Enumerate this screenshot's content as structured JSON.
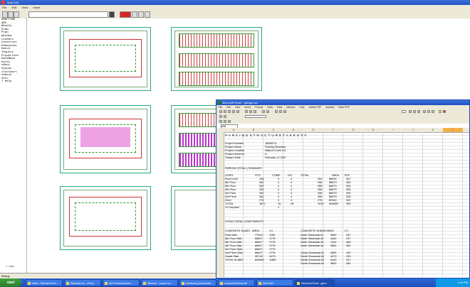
{
  "autocad": {
    "title": "AutoCAD",
    "menu": [
      "File",
      "Edit",
      "View",
      "Insert"
    ],
    "side_commands": [
      "DRAFTING",
      "ARX",
      "Modify",
      "Draw",
      "Plan",
      "Window",
      "Linears",
      "Construct",
      "Dimension",
      "Hatch",
      "Inquire",
      "Properties",
      "DataBase",
      "Units",
      "xBest",
      "Output",
      "xToolbars",
      "xHatch",
      "xEtc",
      "? Help"
    ],
    "status": "Ready",
    "layout_label": "< > A L"
  },
  "excel": {
    "title": "Microsoft Excel - garage.csv",
    "menu": [
      "File",
      "Edit",
      "View",
      "Insert",
      "Format",
      "Tools",
      "Data",
      "Window",
      "Help",
      "Adobe PDF",
      "Acrobat",
      "Inline PDF"
    ],
    "name_box": "A38",
    "columns": [
      "A",
      "B",
      "C",
      "D",
      "E",
      "F",
      "G",
      "H",
      "I",
      "J",
      "K",
      "L",
      "M"
    ],
    "sheet_title": "P A R K I N G   S T R U C T U R E   T A K E O F F",
    "project": [
      [
        "Project Number",
        "JAMEP-A"
      ],
      [
        "Project Name",
        "Parking Structure"
      ],
      [
        "Project Location",
        "Walnut Creek CA"
      ],
      [
        "Project Scheme",
        "A"
      ],
      [
        "Today's Date",
        "February 12 2007"
      ]
    ],
    "stall_summary_title": "PARKING (STALL) SUMMARY",
    "stall_headers": [
      "LEVEL",
      "STD",
      "COMP",
      "H/C",
      "TOTAL",
      "AREA",
      "EFF"
    ],
    "stall_rows": [
      [
        "Roof Level",
        "246",
        "4",
        "4",
        "254",
        "88046",
        "347"
      ],
      [
        "6th Floor",
        "262",
        "4",
        "4",
        "266",
        "86879",
        "326"
      ],
      [
        "5th Floor",
        "262",
        "4",
        "4",
        "266",
        "86879",
        "326"
      ],
      [
        "4th Floor",
        "262",
        "4",
        "4",
        "266",
        "86879",
        "326"
      ],
      [
        "3rd Floor",
        "262",
        "4",
        "4",
        "266",
        "86879",
        "326"
      ],
      [
        "2nd Floor",
        "262",
        "4",
        "4",
        "266",
        "86879",
        "326"
      ],
      [
        "Grnd",
        "270",
        "4",
        "4",
        "278",
        "89160",
        "320"
      ],
      [
        "TOTAL",
        "1871",
        "16",
        "28",
        "1915",
        "604869",
        "326"
      ],
      [
        "% Compact",
        "",
        "1",
        "",
        "",
        "",
        ""
      ]
    ],
    "structural_title": "STRUCTURAL COMPONENTS",
    "struct_headers": [
      "CONCRETE SLABS",
      "AREA",
      "CY",
      "CONCRETE SHEAR AREA",
      "CY"
    ],
    "struct_rows": [
      [
        "Roof Slab",
        "77410",
        "1152",
        "North Shearwall #1",
        "3892",
        "187"
      ],
      [
        "6th Floor Slab",
        "86627",
        "1775",
        "North Shearwall #2",
        "4442",
        "247"
      ],
      [
        "5th Floor Slab",
        "86627",
        "1775",
        "North Shearwall #3",
        "7342",
        "408"
      ],
      [
        "4th Floor Slab",
        "86627",
        "1775",
        "North Shearwall #4",
        "3861",
        "390"
      ],
      [
        "3rd Floor Slab",
        "86627",
        "1775",
        "",
        "",
        ""
      ],
      [
        "2nd Floor Slab",
        "86627",
        "1775",
        "South Shearwall #1",
        "3506",
        "193"
      ],
      [
        "Grade Slab",
        "95718",
        "1479",
        "South Shearwall #2",
        "4470",
        "243"
      ],
      [
        "TOTAL SLABS",
        "849840",
        "11867",
        "South Shearwall #3",
        "4442",
        "247"
      ],
      [
        "",
        "",
        "",
        "South Shearwall #4",
        "3842",
        "390"
      ]
    ]
  },
  "taskbar": {
    "start": "start",
    "tasks": [
      "Inbox - Microsoft Out...",
      "Walkway Inc - [Text]...",
      "Aird Studios/sku/2c...",
      "Sketchy - Launch co...",
      "Monitoring (Microsoft)...",
      "xsolvesAnDoctor.dll",
      "AutoCAD",
      "Microsoft Excel - gara..."
    ],
    "clock": "1:48 PM"
  }
}
